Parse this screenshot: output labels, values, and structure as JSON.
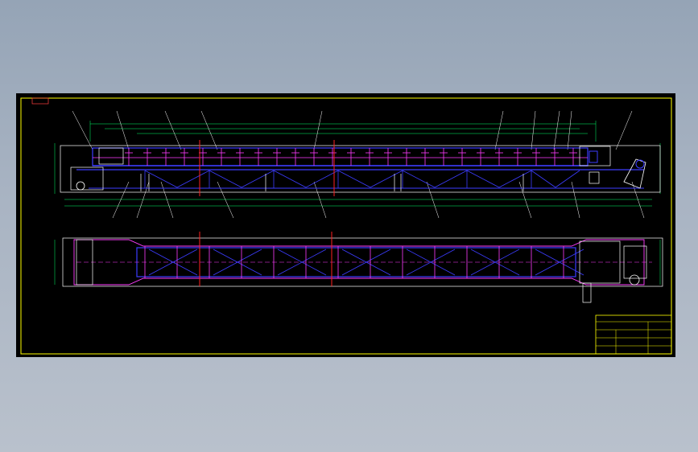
{
  "drawing": {
    "corner_tag": "",
    "title_block": {
      "row1": "",
      "row2": "",
      "row3": "",
      "row4": ""
    },
    "note": ""
  },
  "colors": {
    "background": "#000000",
    "frame": "#ffff00",
    "outline": "#ffffff",
    "structure": "#3c3cff",
    "detail": "#ff3cff",
    "centerline": "#ff2020",
    "dimension": "#00ff66"
  },
  "views": [
    "side-elevation",
    "plan-view"
  ]
}
